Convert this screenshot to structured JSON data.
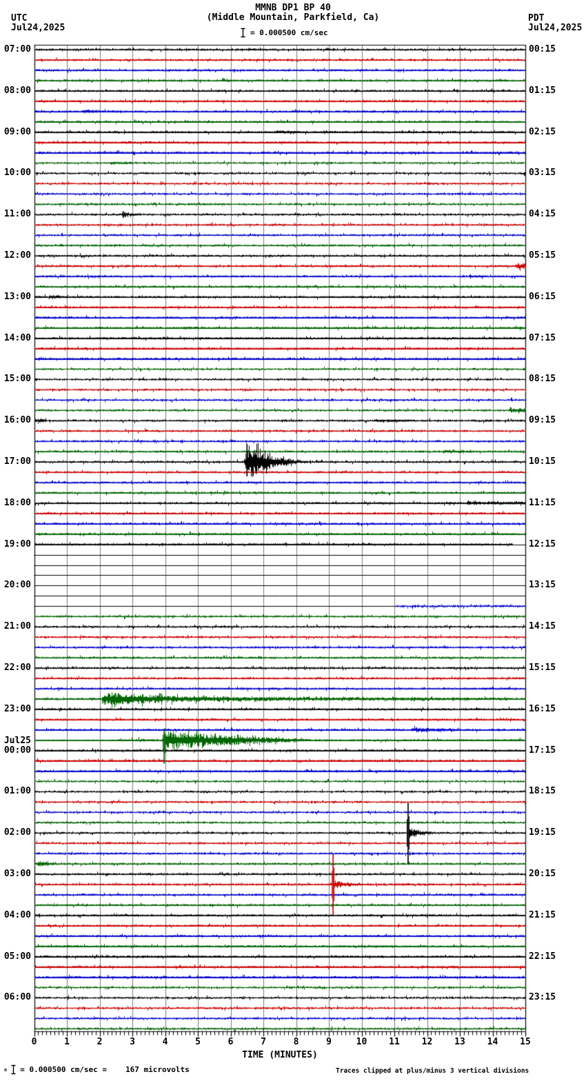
{
  "header": {
    "title": "MMNB DP1 BP 40",
    "subtitle": "(Middle Mountain, Parkfield, Ca)",
    "tz_left": "UTC",
    "date_left": "Jul24,2025",
    "tz_right": "PDT",
    "date_right": "Jul24,2025",
    "scale_label": "= 0.000500 cm/sec"
  },
  "footer": {
    "scale_prefix": "n",
    "scale_equiv": "= 0.000500 cm/sec =",
    "microvolts": "167 microvolts",
    "clip_note": "Traces clipped at plus/minus 3 vertical divisions"
  },
  "colors": {
    "black": "#000000",
    "red": "#cc0000",
    "blue": "#0000cc",
    "green": "#006400",
    "grid": "#7a7a7a",
    "background": "#ffffff"
  },
  "chart_data": {
    "type": "line",
    "subtype": "helicorder",
    "station": "MMNB DP1 BP 40",
    "location": "Middle Mountain, Parkfield, Ca",
    "minutes_per_line": 15,
    "rows_total": 96,
    "trace_color_cycle": [
      "black",
      "red",
      "blue",
      "green"
    ],
    "x_axis": {
      "label": "TIME (MINUTES)",
      "ticks": [
        0,
        1,
        2,
        3,
        4,
        5,
        6,
        7,
        8,
        9,
        10,
        11,
        12,
        13,
        14,
        15
      ],
      "minor_per_minute": 8,
      "range": [
        0,
        15
      ]
    },
    "clip_divisions": 3,
    "day_rollover": {
      "row": 68,
      "label_top": "Jul25",
      "label_bottom": "00:00"
    },
    "hour_rows": [
      {
        "utc": "07:00",
        "pdt": "00:15"
      },
      {
        "utc": "08:00",
        "pdt": "01:15"
      },
      {
        "utc": "09:00",
        "pdt": "02:15"
      },
      {
        "utc": "10:00",
        "pdt": "03:15"
      },
      {
        "utc": "11:00",
        "pdt": "04:15"
      },
      {
        "utc": "12:00",
        "pdt": "05:15"
      },
      {
        "utc": "13:00",
        "pdt": "06:15"
      },
      {
        "utc": "14:00",
        "pdt": "07:15"
      },
      {
        "utc": "15:00",
        "pdt": "08:15"
      },
      {
        "utc": "16:00",
        "pdt": "09:15"
      },
      {
        "utc": "17:00",
        "pdt": "10:15"
      },
      {
        "utc": "18:00",
        "pdt": "11:15"
      },
      {
        "utc": "19:00",
        "pdt": "12:15"
      },
      {
        "utc": "20:00",
        "pdt": "13:15"
      },
      {
        "utc": "21:00",
        "pdt": "14:15"
      },
      {
        "utc": "22:00",
        "pdt": "15:15"
      },
      {
        "utc": "23:00",
        "pdt": "16:15"
      },
      {
        "utc": "00:00",
        "pdt": "17:15"
      },
      {
        "utc": "01:00",
        "pdt": "18:15"
      },
      {
        "utc": "02:00",
        "pdt": "19:15"
      },
      {
        "utc": "03:00",
        "pdt": "20:15"
      },
      {
        "utc": "04:00",
        "pdt": "21:15"
      },
      {
        "utc": "05:00",
        "pdt": "22:15"
      },
      {
        "utc": "06:00",
        "pdt": "23:15"
      }
    ],
    "base_noise_amp": 1.3,
    "segment_overrides": {
      "48": {
        "noise": [
          [
            0,
            14.6,
            1.3
          ]
        ],
        "flat": [
          [
            14.6,
            15
          ]
        ]
      },
      "49": {
        "noise": [],
        "flat": [
          [
            0,
            15
          ]
        ]
      },
      "50": {
        "noise": [],
        "flat": [
          [
            0,
            15
          ]
        ]
      },
      "51": {
        "noise": [],
        "flat": [
          [
            0,
            15
          ]
        ]
      },
      "52": {
        "noise": [],
        "flat": [
          [
            0,
            15
          ]
        ]
      },
      "53": {
        "noise": [],
        "flat": [
          [
            0,
            15
          ]
        ]
      },
      "54": {
        "noise": [
          [
            11.05,
            15,
            1.5
          ]
        ],
        "flat": [
          [
            0,
            11.05
          ]
        ]
      },
      "67": {
        "noise": [
          [
            0,
            2.55,
            0.45
          ],
          [
            2.55,
            3.9,
            1.6
          ],
          [
            3.9,
            15,
            1.3
          ]
        ]
      }
    },
    "events": [
      {
        "row": 6,
        "type": "burst",
        "t0": 1.5,
        "t1": 2.1,
        "a0": 3,
        "a1": 1.6
      },
      {
        "row": 8,
        "type": "burst",
        "t0": 7.35,
        "t1": 8.05,
        "a0": 2.6,
        "a1": 1.5
      },
      {
        "row": 11,
        "type": "burst",
        "t0": 2.3,
        "t1": 3.05,
        "a0": 2.2,
        "a1": 1.4
      },
      {
        "row": 16,
        "type": "spike",
        "t": 2.72,
        "up": 5,
        "dn": 5
      },
      {
        "row": 16,
        "type": "burst",
        "t0": 2.74,
        "t1": 3.15,
        "a0": 2.6,
        "a1": 1.4
      },
      {
        "row": 21,
        "type": "burst",
        "t0": 14.7,
        "t1": 15,
        "a0": 4,
        "a1": 4
      },
      {
        "row": 22,
        "type": "burst",
        "t0": 13.3,
        "t1": 13.8,
        "a0": 2,
        "a1": 1.5
      },
      {
        "row": 24,
        "type": "burst",
        "t0": 0.45,
        "t1": 0.98,
        "a0": 2.8,
        "a1": 1.6
      },
      {
        "row": 27,
        "type": "burst",
        "t0": 4.55,
        "t1": 5.05,
        "a0": 2,
        "a1": 1.4
      },
      {
        "row": 35,
        "type": "burst",
        "t0": 14.5,
        "t1": 15,
        "a0": 2.8,
        "a1": 2.8
      },
      {
        "row": 36,
        "type": "burst",
        "t0": 0,
        "t1": 0.35,
        "a0": 3,
        "a1": 2
      },
      {
        "row": 36,
        "type": "burst",
        "t0": 10.4,
        "t1": 11.6,
        "a0": 2,
        "a1": 1.5
      },
      {
        "row": 39,
        "type": "burst",
        "t0": 12.5,
        "t1": 13.3,
        "a0": 2.2,
        "a1": 1.4
      },
      {
        "row": 40,
        "type": "spike",
        "t": 6.5,
        "up": 26,
        "dn": 21
      },
      {
        "row": 40,
        "type": "burst",
        "t0": 6.42,
        "t1": 6.56,
        "a0": 7,
        "a1": 22
      },
      {
        "row": 40,
        "type": "burst",
        "t0": 6.56,
        "t1": 7.05,
        "a0": 22,
        "a1": 12
      },
      {
        "row": 40,
        "type": "burst",
        "t0": 7.05,
        "t1": 7.55,
        "a0": 12,
        "a1": 6
      },
      {
        "row": 40,
        "type": "burst",
        "t0": 7.55,
        "t1": 8.35,
        "a0": 6,
        "a1": 1.8
      },
      {
        "row": 44,
        "type": "burst",
        "t0": 13.2,
        "t1": 15,
        "a0": 2.2,
        "a1": 2.2
      },
      {
        "row": 63,
        "type": "burst",
        "t0": 2.08,
        "t1": 2.35,
        "a0": 7,
        "a1": 8.5
      },
      {
        "row": 63,
        "type": "burst",
        "t0": 2.35,
        "t1": 4.3,
        "a0": 8.5,
        "a1": 4.5
      },
      {
        "row": 63,
        "type": "burst",
        "t0": 4.3,
        "t1": 6.6,
        "a0": 4.5,
        "a1": 3
      },
      {
        "row": 63,
        "type": "burst",
        "t0": 6.6,
        "t1": 10.5,
        "a0": 3,
        "a1": 2
      },
      {
        "row": 63,
        "type": "burst",
        "t0": 10.5,
        "t1": 14.6,
        "a0": 2,
        "a1": 1.6
      },
      {
        "row": 66,
        "type": "burst",
        "t0": 11.55,
        "t1": 12.05,
        "a0": 3.5,
        "a1": 2.5
      },
      {
        "row": 66,
        "type": "burst",
        "t0": 12.05,
        "t1": 12.95,
        "a0": 2.5,
        "a1": 1.5
      },
      {
        "row": 67,
        "type": "spike",
        "t": 3.97,
        "up": 17,
        "dn": 34
      },
      {
        "row": 67,
        "type": "burst",
        "t0": 4.0,
        "t1": 4.9,
        "a0": 12,
        "a1": 9
      },
      {
        "row": 67,
        "type": "burst",
        "t0": 4.9,
        "t1": 6.3,
        "a0": 9,
        "a1": 6
      },
      {
        "row": 67,
        "type": "burst",
        "t0": 6.3,
        "t1": 7.5,
        "a0": 6,
        "a1": 3.5
      },
      {
        "row": 67,
        "type": "burst",
        "t0": 7.5,
        "t1": 8.4,
        "a0": 3.5,
        "a1": 1.5
      },
      {
        "row": 76,
        "type": "spike",
        "t": 11.42,
        "up": 44,
        "dn": 44
      },
      {
        "row": 76,
        "type": "burst",
        "t0": 11.45,
        "t1": 12.1,
        "a0": 7,
        "a1": 1.8
      },
      {
        "row": 79,
        "type": "burst",
        "t0": 0.12,
        "t1": 0.62,
        "a0": 4,
        "a1": 2
      },
      {
        "row": 81,
        "type": "spike",
        "t": 9.13,
        "up": 44,
        "dn": 44
      },
      {
        "row": 81,
        "type": "burst",
        "t0": 9.16,
        "t1": 9.95,
        "a0": 6,
        "a1": 1.6
      }
    ]
  }
}
